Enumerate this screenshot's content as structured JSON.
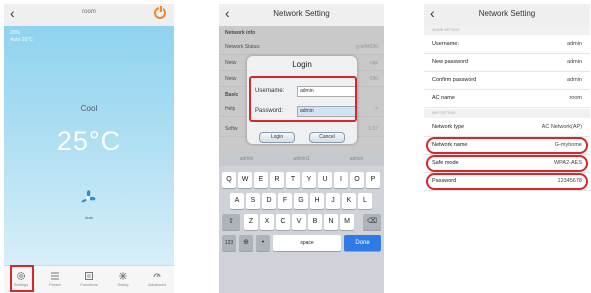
{
  "phone1": {
    "nav_title": "room",
    "status_lines": [
      "25%",
      "Auto 26°C"
    ],
    "mode": "Cool",
    "temperature": "25°C",
    "fan_label": "Auto",
    "tabs": [
      {
        "label": "Settings",
        "icon": "gear-icon"
      },
      {
        "label": "Preset",
        "icon": "list-icon"
      },
      {
        "label": "Functions",
        "icon": "functions-icon"
      },
      {
        "label": "Swing",
        "icon": "swing-icon"
      },
      {
        "label": "Advanced",
        "icon": "advanced-icon"
      }
    ],
    "accent": "#f0892e"
  },
  "phone2": {
    "nav_title": "Network Setting",
    "section1": "Network info",
    "rows": [
      {
        "k": "Network Status:",
        "v": "g-eifi4030"
      },
      {
        "k": "Netw",
        "v": "ngs"
      },
      {
        "k": "Netw",
        "v": "030"
      }
    ],
    "section2": "Basic",
    "rows2": [
      {
        "k": "Help",
        "v": ">"
      },
      {
        "k": "Softw",
        "v": "1.07"
      }
    ],
    "dialog": {
      "title": "Login",
      "username_label": "Username:",
      "username_value": "admin",
      "password_label": "Password:",
      "password_value": "admin",
      "login_button": "Login",
      "cancel_button": "Cancel"
    },
    "suggestions": [
      "admin",
      "admin1",
      "admin"
    ],
    "keys_row1": [
      "Q",
      "W",
      "E",
      "R",
      "T",
      "Y",
      "U",
      "I",
      "O",
      "P"
    ],
    "keys_row2": [
      "A",
      "S",
      "D",
      "F",
      "G",
      "H",
      "J",
      "K",
      "L"
    ],
    "keys_row3": [
      "Z",
      "X",
      "C",
      "V",
      "B",
      "N",
      "M"
    ],
    "space_label": "space",
    "done_label": "Done",
    "mode_key": "123"
  },
  "phone3": {
    "nav_title": "Network Setting",
    "section1": "ADMIN SETTING",
    "rows1": [
      {
        "k": "Username:",
        "v": "admin"
      },
      {
        "k": "New password",
        "v": "admin"
      },
      {
        "k": "Confirm password",
        "v": "admin"
      },
      {
        "k": "AC name",
        "v": "room"
      }
    ],
    "section2": "WIFI SETTING",
    "rows2": [
      {
        "k": "Network type",
        "v": "AC Network(AP)"
      },
      {
        "k": "Network name",
        "v": "G-myhome"
      },
      {
        "k": "Safe mode",
        "v": "WPA2-AES"
      },
      {
        "k": "Password",
        "v": "12345678"
      }
    ]
  },
  "highlight_color": "#d9262b"
}
